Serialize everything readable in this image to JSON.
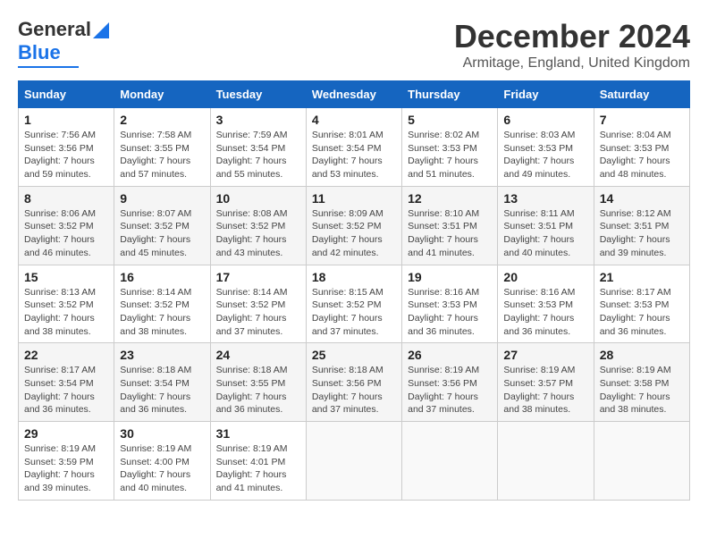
{
  "header": {
    "logo_general": "General",
    "logo_blue": "Blue",
    "month_title": "December 2024",
    "subtitle": "Armitage, England, United Kingdom"
  },
  "calendar": {
    "days_of_week": [
      "Sunday",
      "Monday",
      "Tuesday",
      "Wednesday",
      "Thursday",
      "Friday",
      "Saturday"
    ],
    "weeks": [
      [
        {
          "day": "1",
          "sunrise": "Sunrise: 7:56 AM",
          "sunset": "Sunset: 3:56 PM",
          "daylight": "Daylight: 7 hours and 59 minutes."
        },
        {
          "day": "2",
          "sunrise": "Sunrise: 7:58 AM",
          "sunset": "Sunset: 3:55 PM",
          "daylight": "Daylight: 7 hours and 57 minutes."
        },
        {
          "day": "3",
          "sunrise": "Sunrise: 7:59 AM",
          "sunset": "Sunset: 3:54 PM",
          "daylight": "Daylight: 7 hours and 55 minutes."
        },
        {
          "day": "4",
          "sunrise": "Sunrise: 8:01 AM",
          "sunset": "Sunset: 3:54 PM",
          "daylight": "Daylight: 7 hours and 53 minutes."
        },
        {
          "day": "5",
          "sunrise": "Sunrise: 8:02 AM",
          "sunset": "Sunset: 3:53 PM",
          "daylight": "Daylight: 7 hours and 51 minutes."
        },
        {
          "day": "6",
          "sunrise": "Sunrise: 8:03 AM",
          "sunset": "Sunset: 3:53 PM",
          "daylight": "Daylight: 7 hours and 49 minutes."
        },
        {
          "day": "7",
          "sunrise": "Sunrise: 8:04 AM",
          "sunset": "Sunset: 3:53 PM",
          "daylight": "Daylight: 7 hours and 48 minutes."
        }
      ],
      [
        {
          "day": "8",
          "sunrise": "Sunrise: 8:06 AM",
          "sunset": "Sunset: 3:52 PM",
          "daylight": "Daylight: 7 hours and 46 minutes."
        },
        {
          "day": "9",
          "sunrise": "Sunrise: 8:07 AM",
          "sunset": "Sunset: 3:52 PM",
          "daylight": "Daylight: 7 hours and 45 minutes."
        },
        {
          "day": "10",
          "sunrise": "Sunrise: 8:08 AM",
          "sunset": "Sunset: 3:52 PM",
          "daylight": "Daylight: 7 hours and 43 minutes."
        },
        {
          "day": "11",
          "sunrise": "Sunrise: 8:09 AM",
          "sunset": "Sunset: 3:52 PM",
          "daylight": "Daylight: 7 hours and 42 minutes."
        },
        {
          "day": "12",
          "sunrise": "Sunrise: 8:10 AM",
          "sunset": "Sunset: 3:51 PM",
          "daylight": "Daylight: 7 hours and 41 minutes."
        },
        {
          "day": "13",
          "sunrise": "Sunrise: 8:11 AM",
          "sunset": "Sunset: 3:51 PM",
          "daylight": "Daylight: 7 hours and 40 minutes."
        },
        {
          "day": "14",
          "sunrise": "Sunrise: 8:12 AM",
          "sunset": "Sunset: 3:51 PM",
          "daylight": "Daylight: 7 hours and 39 minutes."
        }
      ],
      [
        {
          "day": "15",
          "sunrise": "Sunrise: 8:13 AM",
          "sunset": "Sunset: 3:52 PM",
          "daylight": "Daylight: 7 hours and 38 minutes."
        },
        {
          "day": "16",
          "sunrise": "Sunrise: 8:14 AM",
          "sunset": "Sunset: 3:52 PM",
          "daylight": "Daylight: 7 hours and 38 minutes."
        },
        {
          "day": "17",
          "sunrise": "Sunrise: 8:14 AM",
          "sunset": "Sunset: 3:52 PM",
          "daylight": "Daylight: 7 hours and 37 minutes."
        },
        {
          "day": "18",
          "sunrise": "Sunrise: 8:15 AM",
          "sunset": "Sunset: 3:52 PM",
          "daylight": "Daylight: 7 hours and 37 minutes."
        },
        {
          "day": "19",
          "sunrise": "Sunrise: 8:16 AM",
          "sunset": "Sunset: 3:53 PM",
          "daylight": "Daylight: 7 hours and 36 minutes."
        },
        {
          "day": "20",
          "sunrise": "Sunrise: 8:16 AM",
          "sunset": "Sunset: 3:53 PM",
          "daylight": "Daylight: 7 hours and 36 minutes."
        },
        {
          "day": "21",
          "sunrise": "Sunrise: 8:17 AM",
          "sunset": "Sunset: 3:53 PM",
          "daylight": "Daylight: 7 hours and 36 minutes."
        }
      ],
      [
        {
          "day": "22",
          "sunrise": "Sunrise: 8:17 AM",
          "sunset": "Sunset: 3:54 PM",
          "daylight": "Daylight: 7 hours and 36 minutes."
        },
        {
          "day": "23",
          "sunrise": "Sunrise: 8:18 AM",
          "sunset": "Sunset: 3:54 PM",
          "daylight": "Daylight: 7 hours and 36 minutes."
        },
        {
          "day": "24",
          "sunrise": "Sunrise: 8:18 AM",
          "sunset": "Sunset: 3:55 PM",
          "daylight": "Daylight: 7 hours and 36 minutes."
        },
        {
          "day": "25",
          "sunrise": "Sunrise: 8:18 AM",
          "sunset": "Sunset: 3:56 PM",
          "daylight": "Daylight: 7 hours and 37 minutes."
        },
        {
          "day": "26",
          "sunrise": "Sunrise: 8:19 AM",
          "sunset": "Sunset: 3:56 PM",
          "daylight": "Daylight: 7 hours and 37 minutes."
        },
        {
          "day": "27",
          "sunrise": "Sunrise: 8:19 AM",
          "sunset": "Sunset: 3:57 PM",
          "daylight": "Daylight: 7 hours and 38 minutes."
        },
        {
          "day": "28",
          "sunrise": "Sunrise: 8:19 AM",
          "sunset": "Sunset: 3:58 PM",
          "daylight": "Daylight: 7 hours and 38 minutes."
        }
      ],
      [
        {
          "day": "29",
          "sunrise": "Sunrise: 8:19 AM",
          "sunset": "Sunset: 3:59 PM",
          "daylight": "Daylight: 7 hours and 39 minutes."
        },
        {
          "day": "30",
          "sunrise": "Sunrise: 8:19 AM",
          "sunset": "Sunset: 4:00 PM",
          "daylight": "Daylight: 7 hours and 40 minutes."
        },
        {
          "day": "31",
          "sunrise": "Sunrise: 8:19 AM",
          "sunset": "Sunset: 4:01 PM",
          "daylight": "Daylight: 7 hours and 41 minutes."
        },
        {
          "day": "",
          "sunrise": "",
          "sunset": "",
          "daylight": ""
        },
        {
          "day": "",
          "sunrise": "",
          "sunset": "",
          "daylight": ""
        },
        {
          "day": "",
          "sunrise": "",
          "sunset": "",
          "daylight": ""
        },
        {
          "day": "",
          "sunrise": "",
          "sunset": "",
          "daylight": ""
        }
      ]
    ]
  }
}
